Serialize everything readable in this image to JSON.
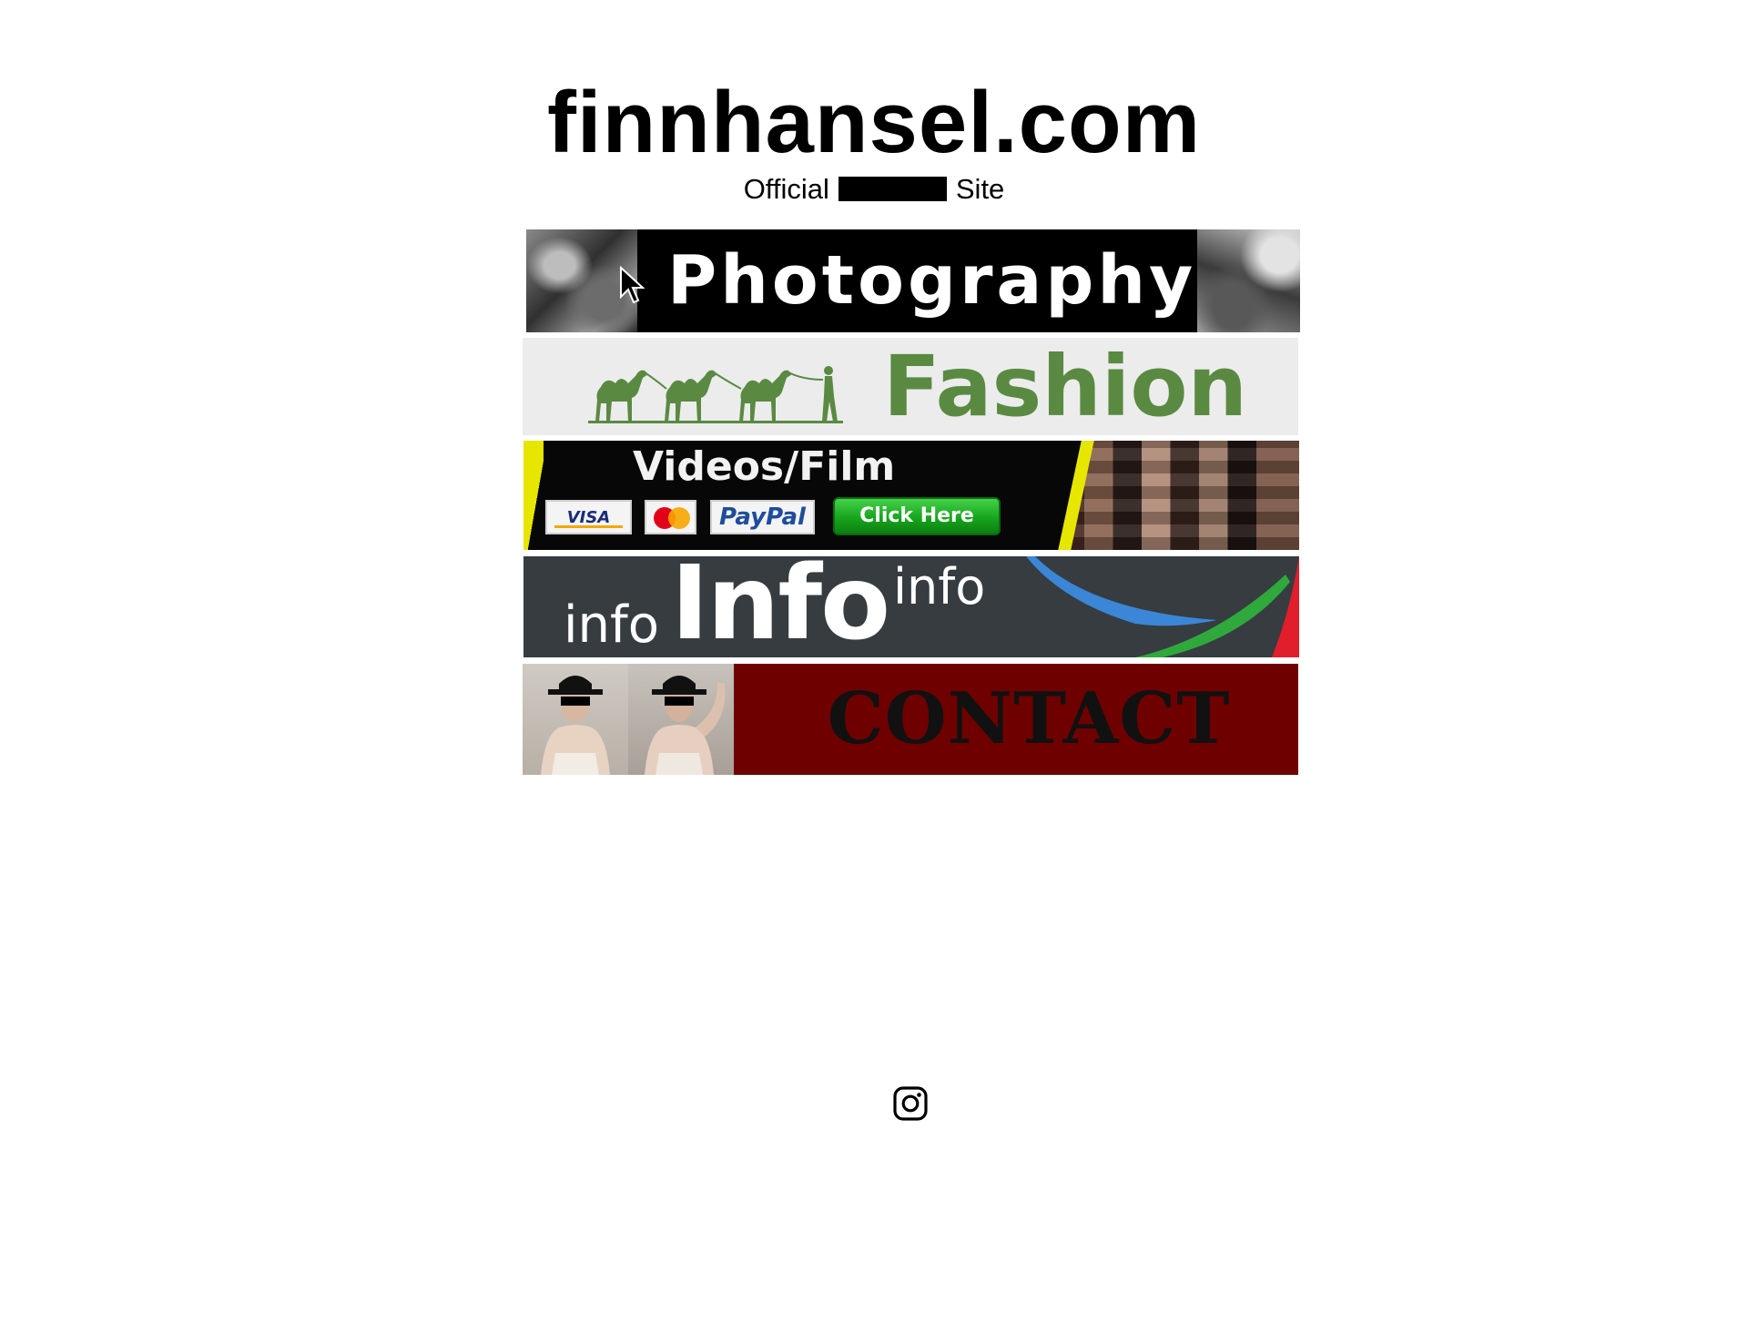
{
  "header": {
    "site_title": "finnhansel.com",
    "tagline_before": "Official",
    "tagline_after": "Site"
  },
  "banners": {
    "photography": {
      "label": "Photography"
    },
    "fashion": {
      "label": "Fashion"
    },
    "videos": {
      "title": "Videos/Film",
      "visa_label": "VISA",
      "paypal_label": "PayPal",
      "button_label": "Click Here"
    },
    "info": {
      "small": "info",
      "big": "Info",
      "superscript": "info"
    },
    "contact": {
      "label": "CONTACT"
    }
  },
  "colors": {
    "fashion_green": "#5a8a42",
    "contact_red": "#6e0000",
    "info_slate": "#363c40",
    "button_green": "#17a51c"
  },
  "icons": {
    "social": "instagram-icon"
  }
}
